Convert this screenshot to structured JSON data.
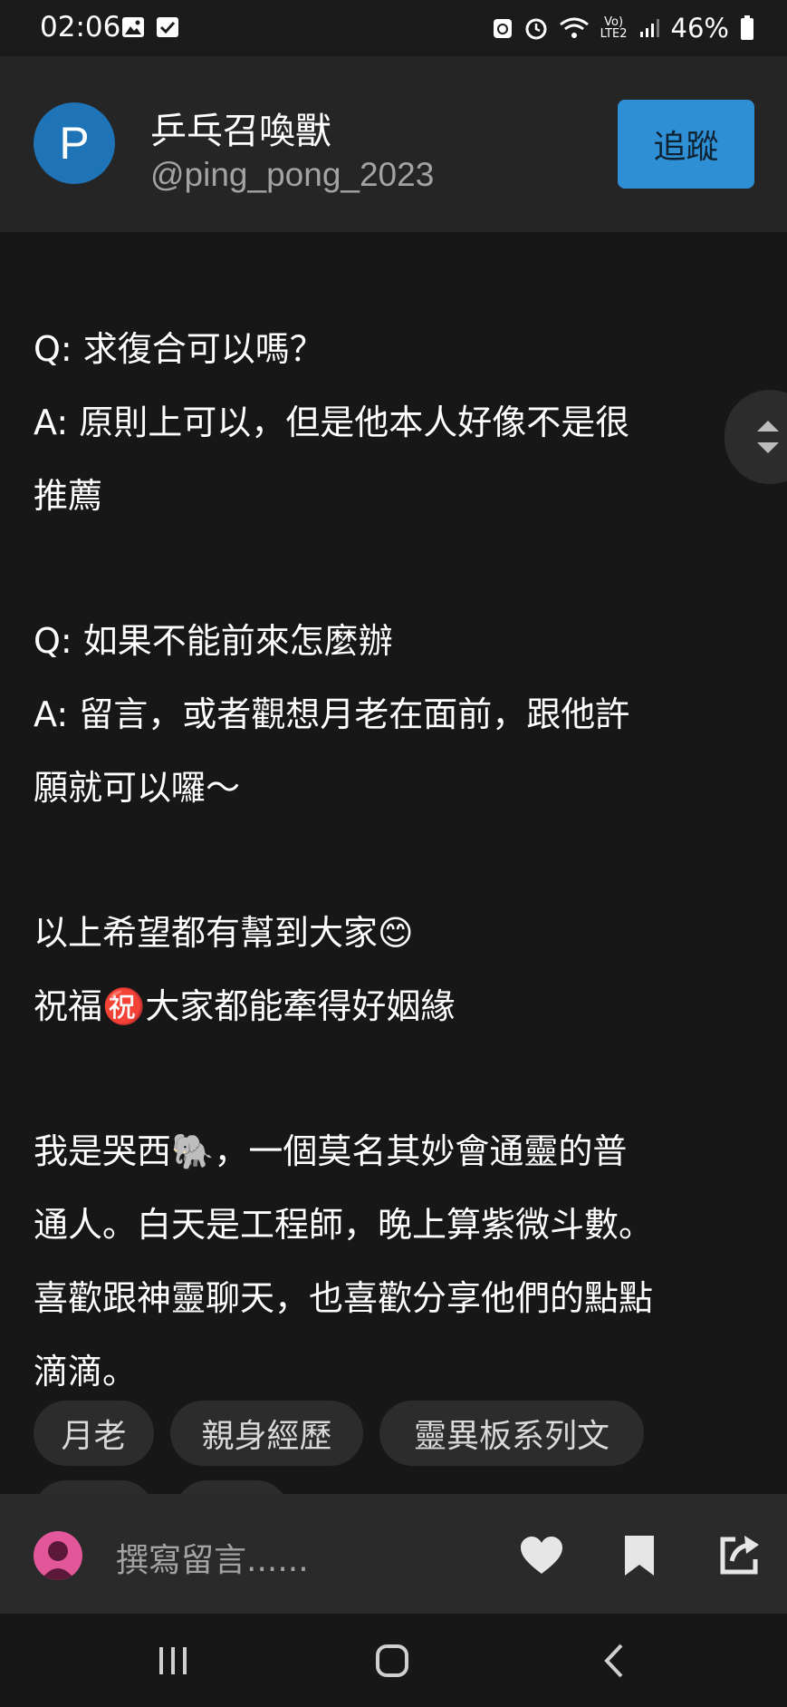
{
  "status": {
    "time": "02:06",
    "battery": "46%",
    "network": "LTE2"
  },
  "author": {
    "avatar_letter": "P",
    "name": "乒乓召喚獸",
    "handle": "@ping_pong_2023",
    "follow_label": "追蹤"
  },
  "post": {
    "lines": {
      "l1": "Q: 求復合可以嗎？",
      "l2": "A: 原則上可以，但是他本人好像不是很",
      "l3": "推薦",
      "l4": "Q: 如果不能前來怎麼辦",
      "l5": "A: 留言，或者觀想月老在面前，跟他許",
      "l6": "願就可以囉～",
      "l7": "以上希望都有幫到大家😊",
      "l8": "祝福㊗️大家都能牽得好姻緣",
      "l9": "我是哭西🐘，一個莫名其妙會通靈的普",
      "l10": "通人。白天是工程師，晚上算紫微斗數。",
      "l11": "喜歡跟神靈聊天，也喜歡分享他們的點點",
      "l12": "滴滴。"
    }
  },
  "tags": [
    "月老",
    "親身經歷",
    "靈異板系列文"
  ],
  "bottom": {
    "comment_placeholder": "撰寫留言......"
  },
  "icons": {
    "like": "heart-icon",
    "bookmark": "bookmark-icon",
    "share": "share-icon",
    "recent": "recent-apps-icon",
    "home": "home-icon",
    "back": "back-icon"
  },
  "colors": {
    "accent": "#2f8fd4",
    "avatar": "#1f73b7",
    "background": "#171717",
    "header": "#252525"
  }
}
